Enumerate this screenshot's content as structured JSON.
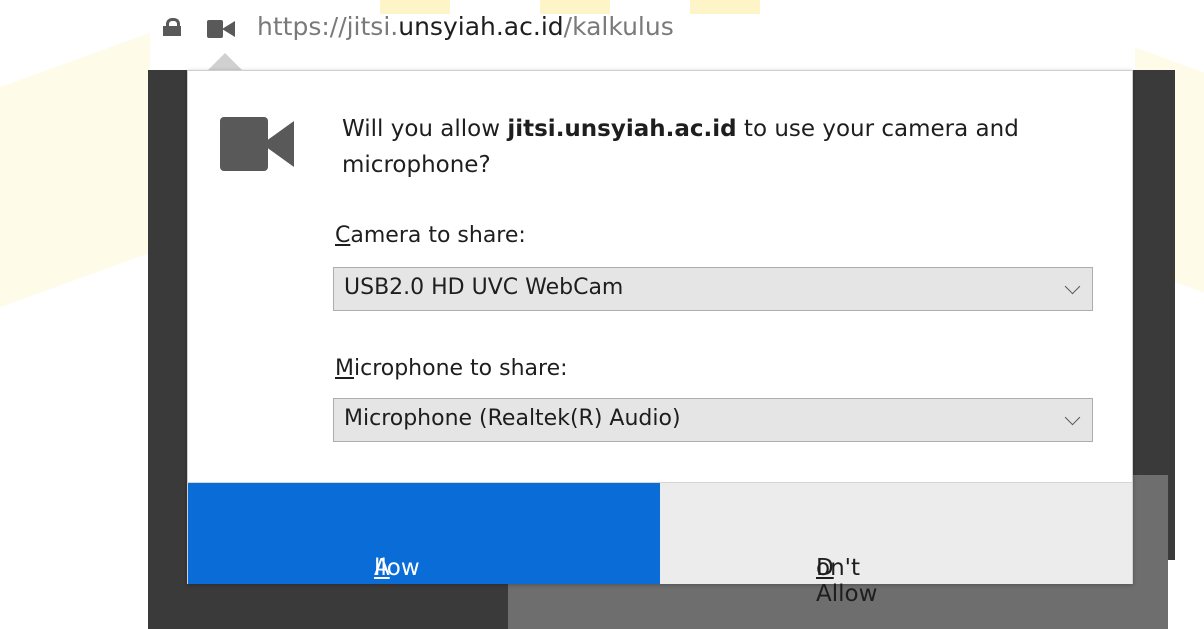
{
  "address_bar": {
    "url_prefix": "https://jitsi.",
    "url_host": "unsyiah.ac.id",
    "url_path": "/kalkulus",
    "icons": [
      "lock-icon",
      "camera-icon"
    ]
  },
  "prompt": {
    "question_before": "Will you allow ",
    "question_site": "jitsi.unsyiah.ac.id",
    "question_after": " to use your camera and microphone?",
    "icon": "camera-icon",
    "camera_label_mnemonic": "C",
    "camera_label_rest": "amera to share:",
    "camera_selected": "USB2.0 HD UVC WebCam",
    "microphone_label_mnemonic": "M",
    "microphone_label_rest": "icrophone to share:",
    "microphone_selected": "Microphone (Realtek(R) Audio)",
    "allow_mnemonic": "A",
    "allow_rest": "llow",
    "deny_mnemonic": "D",
    "deny_rest": "on't Allow"
  },
  "colors": {
    "allow_button": "#0a6cd6",
    "deny_button": "#ececec",
    "icon_gray": "#595959"
  }
}
